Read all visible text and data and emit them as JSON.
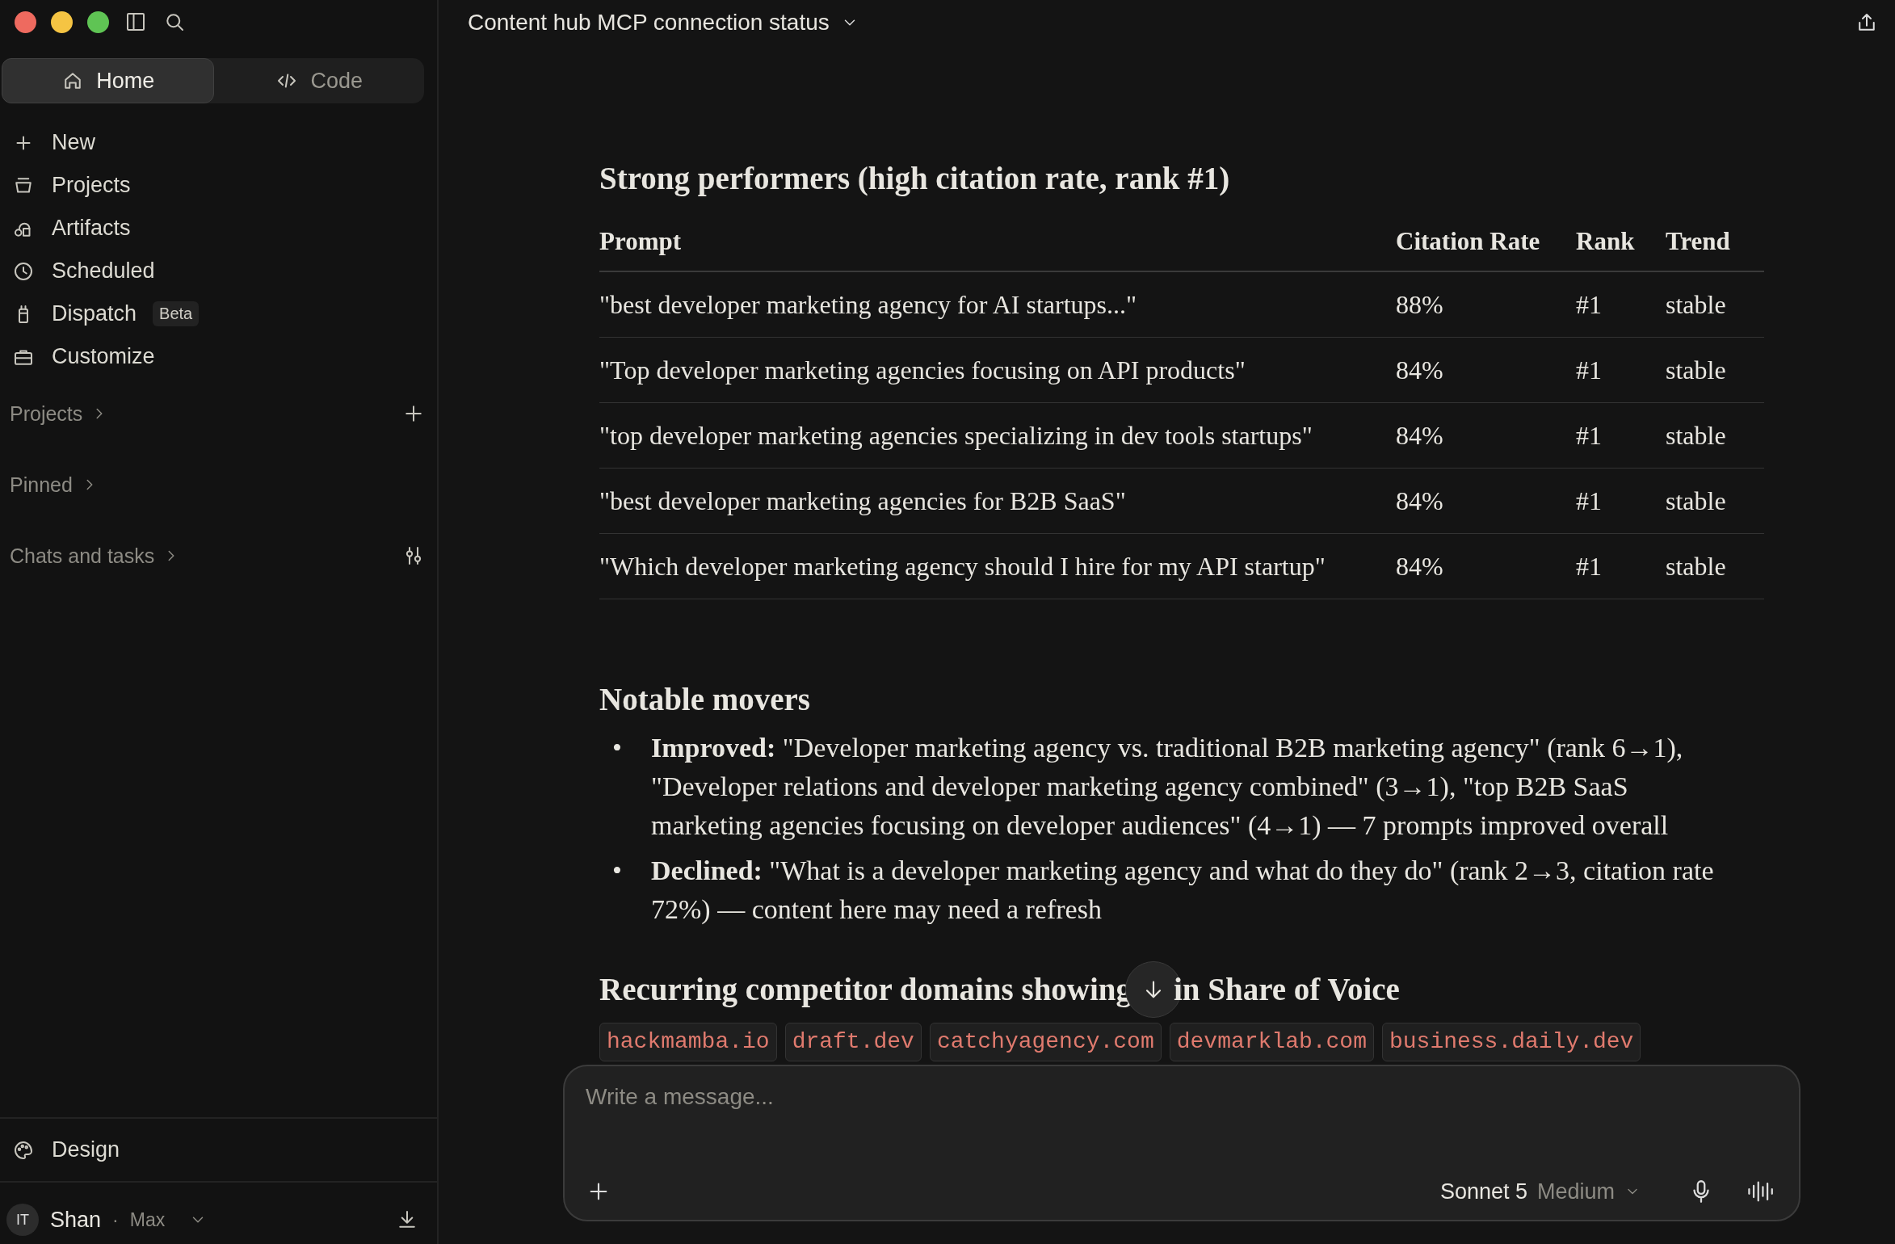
{
  "sidebar": {
    "tabs": [
      {
        "label": "Home",
        "selected": true
      },
      {
        "label": "Code",
        "selected": false
      }
    ],
    "nav": [
      {
        "label": "New"
      },
      {
        "label": "Projects"
      },
      {
        "label": "Artifacts"
      },
      {
        "label": "Scheduled"
      },
      {
        "label": "Dispatch",
        "badge": "Beta"
      },
      {
        "label": "Customize"
      }
    ],
    "sections": [
      {
        "label": "Projects"
      },
      {
        "label": "Pinned"
      },
      {
        "label": "Chats and tasks"
      }
    ],
    "footer_item": {
      "label": "Design"
    },
    "user": {
      "initials": "IT",
      "name": "Shan",
      "separator": "·",
      "plan": "Max"
    }
  },
  "header": {
    "title": "Content hub MCP connection status"
  },
  "content": {
    "strong_heading": "Strong performers (high citation rate, rank #1)",
    "table": {
      "columns": [
        "Prompt",
        "Citation Rate",
        "Rank",
        "Trend"
      ],
      "rows": [
        [
          "\"best developer marketing agency for AI startups...\"",
          "88%",
          "#1",
          "stable"
        ],
        [
          "\"Top developer marketing agencies focusing on API products\"",
          "84%",
          "#1",
          "stable"
        ],
        [
          "\"top developer marketing agencies specializing in dev tools startups\"",
          "84%",
          "#1",
          "stable"
        ],
        [
          "\"best developer marketing agencies for B2B SaaS\"",
          "84%",
          "#1",
          "stable"
        ],
        [
          "\"Which developer marketing agency should I hire for my API startup\"",
          "84%",
          "#1",
          "stable"
        ]
      ]
    },
    "movers_heading": "Notable movers",
    "movers": [
      {
        "marker": "•",
        "text": "**Improved:** \"Developer marketing agency vs. traditional B2B marketing agency\" (rank 6→1), \"Developer relations and developer marketing agency combined\" (3→1), \"top B2B SaaS marketing agencies focusing on developer audiences\" (4→1) — 7 prompts improved overall"
      },
      {
        "marker": "•",
        "text": "**Declined:** \"What is a developer marketing agency and what do they do\" (rank 2→3, citation rate 72%) — content here may need a refresh"
      }
    ],
    "domains_heading_start": "Recurring competitor domains showing",
    "domains_heading_end": "in Share of Voice",
    "domains": [
      "hackmamba.io",
      "draft.dev",
      "catchyagency.com",
      "devmarklab.com",
      "business.daily.dev"
    ]
  },
  "composer": {
    "placeholder": "Write a message...",
    "model": "Sonnet 5",
    "effort": "Medium"
  }
}
